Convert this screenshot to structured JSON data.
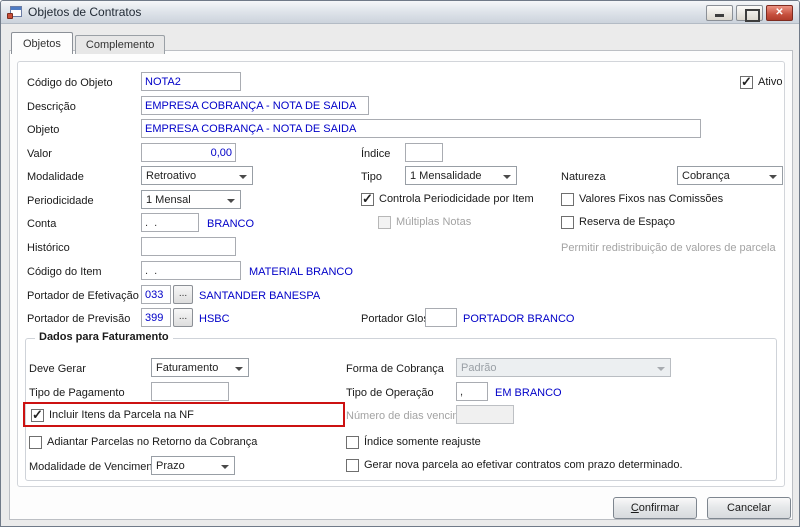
{
  "window": {
    "title": "Objetos de Contratos"
  },
  "tabs": {
    "objetos": "Objetos",
    "complemento": "Complemento"
  },
  "fields": {
    "codigo_objeto": {
      "label": "Código do Objeto",
      "value": "NOTA2"
    },
    "ativo": {
      "label": "Ativo",
      "checked": true
    },
    "descricao": {
      "label": "Descrição",
      "value": "EMPRESA COBRANÇA - NOTA DE SAIDA"
    },
    "objeto": {
      "label": "Objeto",
      "value": "EMPRESA COBRANÇA - NOTA DE SAIDA"
    },
    "valor": {
      "label": "Valor",
      "value": "0,00"
    },
    "indice": {
      "label": "Índice",
      "value": ""
    },
    "modalidade": {
      "label": "Modalidade",
      "value": "Retroativo"
    },
    "tipo": {
      "label": "Tipo",
      "value": "1 Mensalidade"
    },
    "natureza": {
      "label": "Natureza",
      "value": "Cobrança"
    },
    "periodicidade": {
      "label": "Periodicidade",
      "value": "1 Mensal"
    },
    "controla_periodicidade": {
      "label": "Controla Periodicidade por Item",
      "checked": true
    },
    "valores_fixos": {
      "label": "Valores Fixos nas Comissões",
      "checked": false
    },
    "conta": {
      "label": "Conta",
      "value": ".  .",
      "ref": "BRANCO"
    },
    "multiplas_notas": {
      "label": "Múltiplas Notas",
      "checked": false,
      "disabled": true
    },
    "reserva_espaco": {
      "label": "Reserva de Espaço",
      "checked": false
    },
    "historico": {
      "label": "Histórico",
      "value": ""
    },
    "permitir_redistribuicao": {
      "label": "Permitir redistribuição de valores de parcela",
      "disabled": true
    },
    "codigo_item": {
      "label": "Código do Item",
      "value": ".  .",
      "ref": "MATERIAL BRANCO"
    },
    "portador_efetivacao": {
      "label": "Portador de Efetivação",
      "value": "033",
      "ref": "SANTANDER BANESPA"
    },
    "portador_previsao": {
      "label": "Portador de Previsão",
      "value": "399",
      "ref": "HSBC"
    },
    "portador_glosa": {
      "label": "Portador Glosa",
      "value": "",
      "ref": "PORTADOR BRANCO"
    }
  },
  "faturamento": {
    "title": "Dados para Faturamento",
    "deve_gerar": {
      "label": "Deve Gerar",
      "value": "Faturamento"
    },
    "forma_cobranca": {
      "label": "Forma de Cobrança",
      "value": "Padrão",
      "disabled": true
    },
    "tipo_pagamento": {
      "label": "Tipo de Pagamento",
      "value": ""
    },
    "tipo_operacao": {
      "label": "Tipo de Operação",
      "value": ",",
      "ref": "EM BRANCO"
    },
    "incluir_itens": {
      "label": "Incluir Itens da Parcela na NF",
      "checked": true,
      "highlighted": true
    },
    "numero_dias": {
      "label": "Número de dias vencimento",
      "value": "",
      "disabled": true
    },
    "adiantar_parcelas": {
      "label": "Adiantar Parcelas no Retorno da Cobrança",
      "checked": false
    },
    "indice_reajuste": {
      "label": "Índice somente reajuste",
      "checked": false
    },
    "modalidade_vencimento": {
      "label": "Modalidade de Vencimento",
      "value": "Prazo"
    },
    "gerar_nova_parcela": {
      "label": "Gerar nova parcela ao efetivar contratos com prazo determinado.",
      "checked": false
    }
  },
  "buttons": {
    "confirmar": "Confirmar",
    "cancelar": "Cancelar",
    "ellipsis": "..."
  },
  "colors": {
    "value_text": "#0000C8",
    "highlight": "#CC1111"
  }
}
